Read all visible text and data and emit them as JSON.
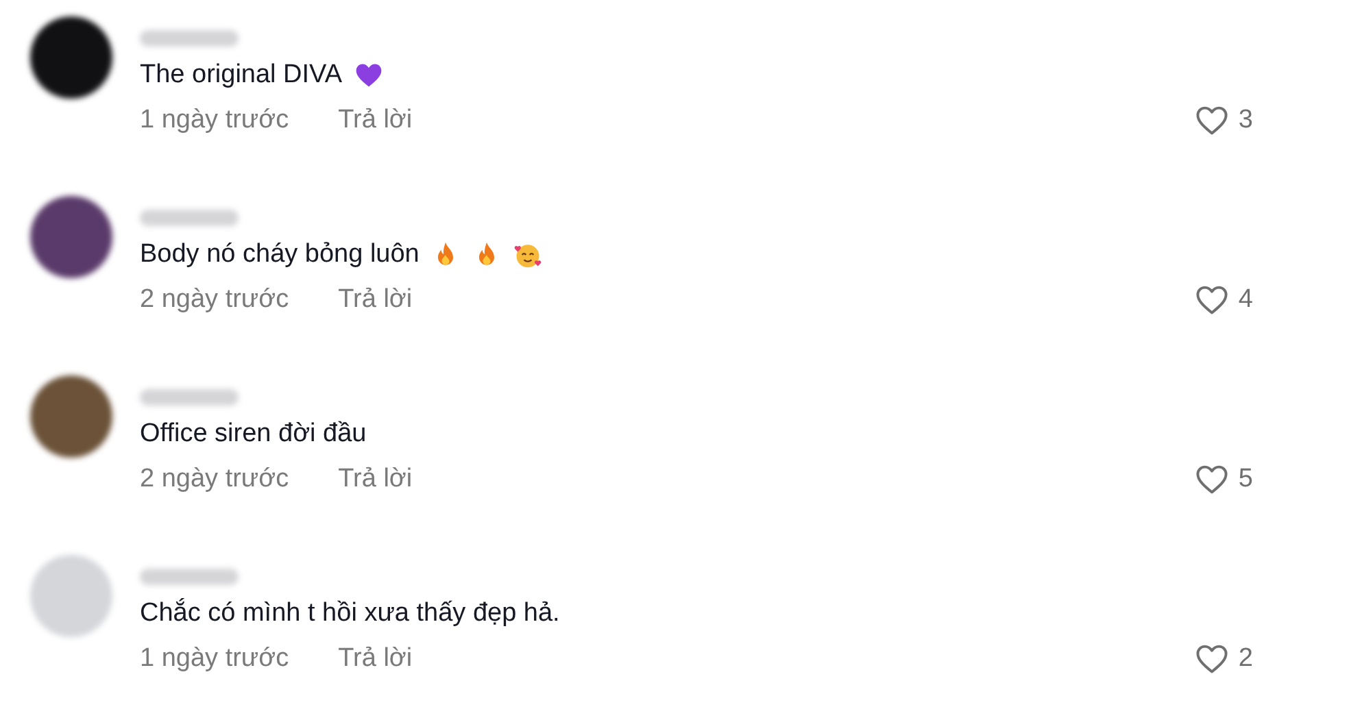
{
  "comments": [
    {
      "color": "#111114",
      "text": "The original DIVA",
      "emojis": [
        {
          "kind": "purple-heart"
        }
      ],
      "time": "1 ngày trước",
      "reply": "Trả lời",
      "likes": "3"
    },
    {
      "color": "#5a3a6a",
      "text": "Body nó cháy bỏng luôn",
      "emojis": [
        {
          "kind": "fire"
        },
        {
          "kind": "fire"
        },
        {
          "kind": "smiling-hearts"
        }
      ],
      "time": "2 ngày trước",
      "reply": "Trả lời",
      "likes": "4"
    },
    {
      "color": "#6b5238",
      "text": "Office siren đời đầu",
      "time": "2 ngày trước",
      "reply": "Trả lời",
      "likes": "5"
    },
    {
      "color": "#d4d6da",
      "text": "Chắc có mình t hồi xưa thấy đẹp hả.",
      "time": "1 ngày trước",
      "reply": "Trả lời",
      "likes": "2"
    }
  ]
}
